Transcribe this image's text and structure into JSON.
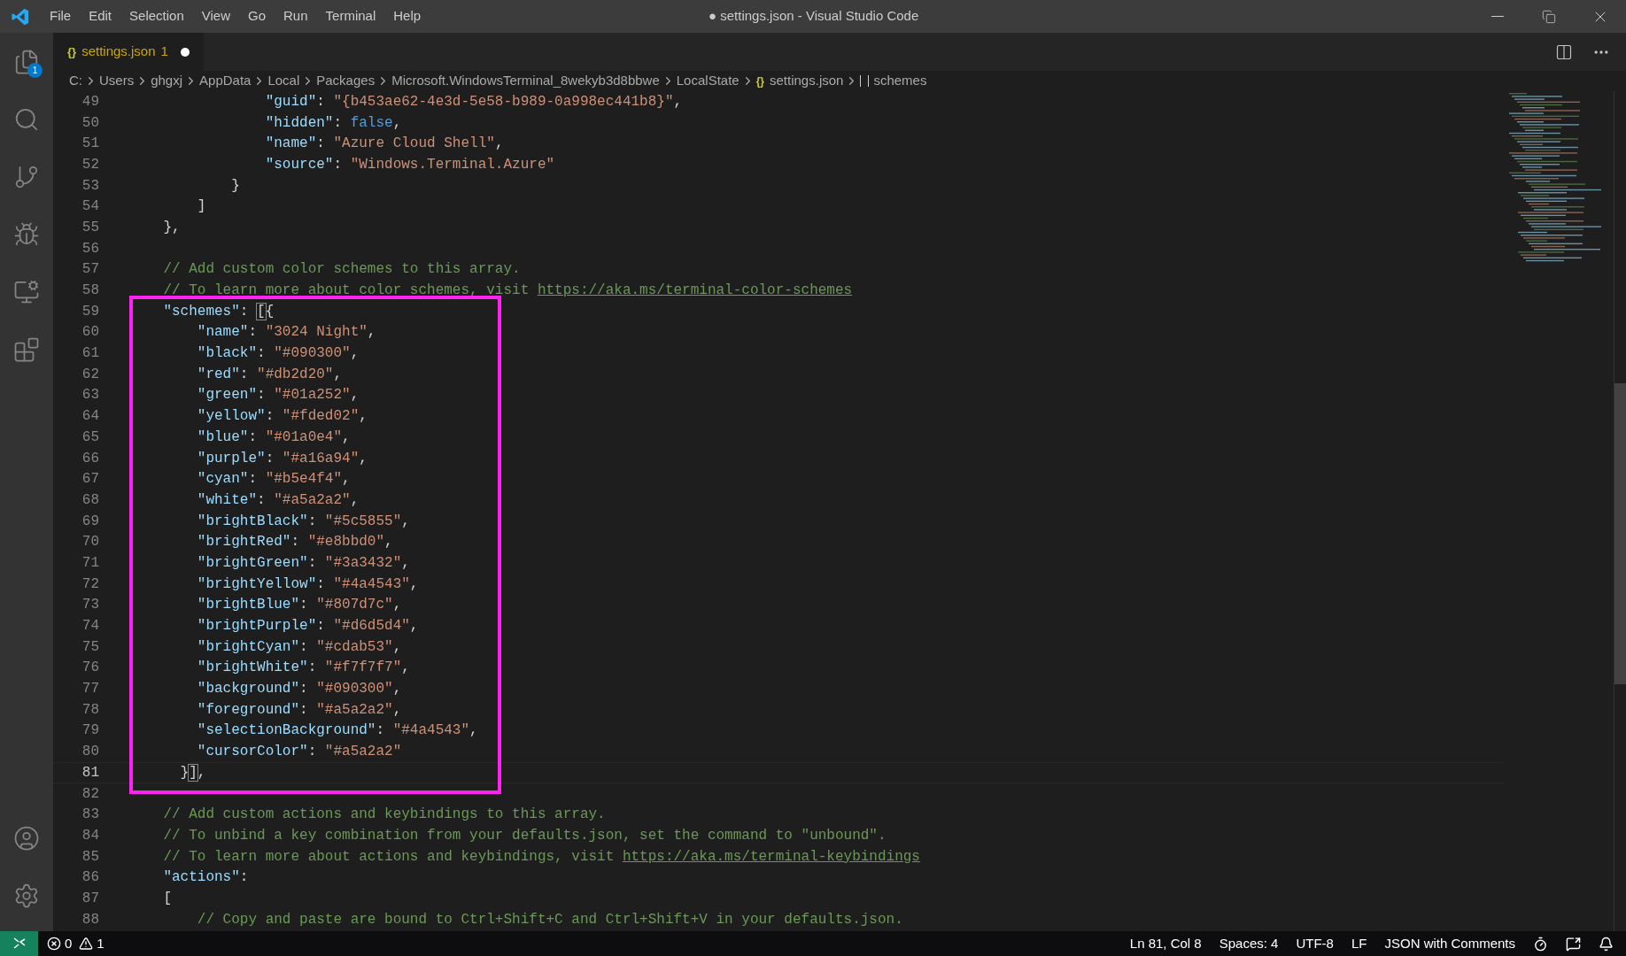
{
  "window": {
    "title": "● settings.json - Visual Studio Code",
    "menu": [
      "File",
      "Edit",
      "Selection",
      "View",
      "Go",
      "Run",
      "Terminal",
      "Help"
    ]
  },
  "activity_bar": {
    "top": [
      {
        "kind": "files",
        "badge": "1",
        "selected": false
      },
      {
        "kind": "search",
        "selected": false
      },
      {
        "kind": "source-control",
        "selected": false
      },
      {
        "kind": "run",
        "selected": false
      },
      {
        "kind": "remote",
        "selected": false
      },
      {
        "kind": "extensions",
        "selected": false
      }
    ],
    "bottom": [
      {
        "kind": "account"
      },
      {
        "kind": "settings"
      }
    ]
  },
  "tabs": [
    {
      "icon": "{}",
      "label": "settings.json",
      "problems": "1",
      "modified": true,
      "selected": true
    }
  ],
  "breadcrumb": [
    {
      "kind": "text",
      "label": "C:"
    },
    {
      "kind": "text",
      "label": "Users"
    },
    {
      "kind": "text",
      "label": "ghgxj"
    },
    {
      "kind": "text",
      "label": "AppData"
    },
    {
      "kind": "text",
      "label": "Local"
    },
    {
      "kind": "text",
      "label": "Packages"
    },
    {
      "kind": "text",
      "label": "Microsoft.WindowsTerminal_8wekyb3d8bbwe"
    },
    {
      "kind": "text",
      "label": "LocalState"
    },
    {
      "kind": "file",
      "icon": "{}",
      "label": "settings.json"
    },
    {
      "kind": "array",
      "label": "schemes"
    }
  ],
  "editor": {
    "blocks": [
      {
        "framed": false,
        "lines": [
          {
            "number": "49",
            "current": false,
            "tokens": [
              {
                "kind": "key",
                "text": "                \"guid\""
              },
              {
                "kind": "punct",
                "text": ": "
              },
              {
                "kind": "string",
                "text": "\"{b453ae62-4e3d-5e58-b989-0a998ec441b8}\""
              },
              {
                "kind": "punct",
                "text": ","
              }
            ]
          },
          {
            "number": "50",
            "current": false,
            "tokens": [
              {
                "kind": "key",
                "text": "                \"hidden\""
              },
              {
                "kind": "punct",
                "text": ": "
              },
              {
                "kind": "keyword",
                "text": "false"
              },
              {
                "kind": "punct",
                "text": ","
              }
            ]
          },
          {
            "number": "51",
            "current": false,
            "tokens": [
              {
                "kind": "key",
                "text": "                \"name\""
              },
              {
                "kind": "punct",
                "text": ": "
              },
              {
                "kind": "string",
                "text": "\"Azure Cloud Shell\""
              },
              {
                "kind": "punct",
                "text": ","
              }
            ]
          },
          {
            "number": "52",
            "current": false,
            "tokens": [
              {
                "kind": "key",
                "text": "                \"source\""
              },
              {
                "kind": "punct",
                "text": ": "
              },
              {
                "kind": "string",
                "text": "\"Windows.Terminal.Azure\""
              }
            ]
          },
          {
            "number": "53",
            "current": false,
            "tokens": [
              {
                "kind": "punct",
                "text": "            }"
              }
            ]
          },
          {
            "number": "54",
            "current": false,
            "tokens": [
              {
                "kind": "punct",
                "text": "        ]"
              }
            ]
          },
          {
            "number": "55",
            "current": false,
            "tokens": [
              {
                "kind": "punct",
                "text": "    },"
              }
            ]
          },
          {
            "number": "56",
            "current": false
          },
          {
            "number": "57",
            "current": false,
            "tokens": [
              {
                "kind": "comment",
                "text": "    // Add custom color schemes to this array."
              }
            ]
          },
          {
            "number": "58",
            "current": false,
            "tokens": [
              {
                "kind": "comment",
                "text": "    // To learn more about color schemes, visit "
              },
              {
                "kind": "link",
                "text": "https://aka.ms/terminal-color-schemes"
              }
            ]
          }
        ]
      },
      {
        "framed": true,
        "lines": [
          {
            "number": "59",
            "current": false,
            "tokens": [
              {
                "kind": "key",
                "text": "    \"schemes\""
              },
              {
                "kind": "punct",
                "text": ": "
              },
              {
                "kind": "bracket",
                "text": "["
              },
              {
                "kind": "punct",
                "text": "{"
              }
            ]
          },
          {
            "number": "60",
            "current": false,
            "tokens": [
              {
                "kind": "key",
                "text": "        \"name\""
              },
              {
                "kind": "punct",
                "text": ": "
              },
              {
                "kind": "string",
                "text": "\"3024 Night\""
              },
              {
                "kind": "punct",
                "text": ","
              }
            ]
          },
          {
            "number": "61",
            "current": false,
            "tokens": [
              {
                "kind": "key",
                "text": "        \"black\""
              },
              {
                "kind": "punct",
                "text": ": "
              },
              {
                "kind": "string",
                "text": "\"#090300\""
              },
              {
                "kind": "punct",
                "text": ","
              }
            ]
          },
          {
            "number": "62",
            "current": false,
            "tokens": [
              {
                "kind": "key",
                "text": "        \"red\""
              },
              {
                "kind": "punct",
                "text": ": "
              },
              {
                "kind": "string",
                "text": "\"#db2d20\""
              },
              {
                "kind": "punct",
                "text": ","
              }
            ]
          },
          {
            "number": "63",
            "current": false,
            "tokens": [
              {
                "kind": "key",
                "text": "        \"green\""
              },
              {
                "kind": "punct",
                "text": ": "
              },
              {
                "kind": "string",
                "text": "\"#01a252\""
              },
              {
                "kind": "punct",
                "text": ","
              }
            ]
          },
          {
            "number": "64",
            "current": false,
            "tokens": [
              {
                "kind": "key",
                "text": "        \"yellow\""
              },
              {
                "kind": "punct",
                "text": ": "
              },
              {
                "kind": "string",
                "text": "\"#fded02\""
              },
              {
                "kind": "punct",
                "text": ","
              }
            ]
          },
          {
            "number": "65",
            "current": false,
            "tokens": [
              {
                "kind": "key",
                "text": "        \"blue\""
              },
              {
                "kind": "punct",
                "text": ": "
              },
              {
                "kind": "string",
                "text": "\"#01a0e4\""
              },
              {
                "kind": "punct",
                "text": ","
              }
            ]
          },
          {
            "number": "66",
            "current": false,
            "tokens": [
              {
                "kind": "key",
                "text": "        \"purple\""
              },
              {
                "kind": "punct",
                "text": ": "
              },
              {
                "kind": "string",
                "text": "\"#a16a94\""
              },
              {
                "kind": "punct",
                "text": ","
              }
            ]
          },
          {
            "number": "67",
            "current": false,
            "tokens": [
              {
                "kind": "key",
                "text": "        \"cyan\""
              },
              {
                "kind": "punct",
                "text": ": "
              },
              {
                "kind": "string",
                "text": "\"#b5e4f4\""
              },
              {
                "kind": "punct",
                "text": ","
              }
            ]
          },
          {
            "number": "68",
            "current": false,
            "tokens": [
              {
                "kind": "key",
                "text": "        \"white\""
              },
              {
                "kind": "punct",
                "text": ": "
              },
              {
                "kind": "string",
                "text": "\"#a5a2a2\""
              },
              {
                "kind": "punct",
                "text": ","
              }
            ]
          },
          {
            "number": "69",
            "current": false,
            "tokens": [
              {
                "kind": "key",
                "text": "        \"brightBlack\""
              },
              {
                "kind": "punct",
                "text": ": "
              },
              {
                "kind": "string",
                "text": "\"#5c5855\""
              },
              {
                "kind": "punct",
                "text": ","
              }
            ]
          },
          {
            "number": "70",
            "current": false,
            "tokens": [
              {
                "kind": "key",
                "text": "        \"brightRed\""
              },
              {
                "kind": "punct",
                "text": ": "
              },
              {
                "kind": "string",
                "text": "\"#e8bbd0\""
              },
              {
                "kind": "punct",
                "text": ","
              }
            ]
          },
          {
            "number": "71",
            "current": false,
            "tokens": [
              {
                "kind": "key",
                "text": "        \"brightGreen\""
              },
              {
                "kind": "punct",
                "text": ": "
              },
              {
                "kind": "string",
                "text": "\"#3a3432\""
              },
              {
                "kind": "punct",
                "text": ","
              }
            ]
          },
          {
            "number": "72",
            "current": false,
            "tokens": [
              {
                "kind": "key",
                "text": "        \"brightYellow\""
              },
              {
                "kind": "punct",
                "text": ": "
              },
              {
                "kind": "string",
                "text": "\"#4a4543\""
              },
              {
                "kind": "punct",
                "text": ","
              }
            ]
          },
          {
            "number": "73",
            "current": false,
            "tokens": [
              {
                "kind": "key",
                "text": "        \"brightBlue\""
              },
              {
                "kind": "punct",
                "text": ": "
              },
              {
                "kind": "string",
                "text": "\"#807d7c\""
              },
              {
                "kind": "punct",
                "text": ","
              }
            ]
          },
          {
            "number": "74",
            "current": false,
            "tokens": [
              {
                "kind": "key",
                "text": "        \"brightPurple\""
              },
              {
                "kind": "punct",
                "text": ": "
              },
              {
                "kind": "string",
                "text": "\"#d6d5d4\""
              },
              {
                "kind": "punct",
                "text": ","
              }
            ]
          },
          {
            "number": "75",
            "current": false,
            "tokens": [
              {
                "kind": "key",
                "text": "        \"brightCyan\""
              },
              {
                "kind": "punct",
                "text": ": "
              },
              {
                "kind": "string",
                "text": "\"#cdab53\""
              },
              {
                "kind": "punct",
                "text": ","
              }
            ]
          },
          {
            "number": "76",
            "current": false,
            "tokens": [
              {
                "kind": "key",
                "text": "        \"brightWhite\""
              },
              {
                "kind": "punct",
                "text": ": "
              },
              {
                "kind": "string",
                "text": "\"#f7f7f7\""
              },
              {
                "kind": "punct",
                "text": ","
              }
            ]
          },
          {
            "number": "77",
            "current": false,
            "tokens": [
              {
                "kind": "key",
                "text": "        \"background\""
              },
              {
                "kind": "punct",
                "text": ": "
              },
              {
                "kind": "string",
                "text": "\"#090300\""
              },
              {
                "kind": "punct",
                "text": ","
              }
            ]
          },
          {
            "number": "78",
            "current": false,
            "tokens": [
              {
                "kind": "key",
                "text": "        \"foreground\""
              },
              {
                "kind": "punct",
                "text": ": "
              },
              {
                "kind": "string",
                "text": "\"#a5a2a2\""
              },
              {
                "kind": "punct",
                "text": ","
              }
            ]
          },
          {
            "number": "79",
            "current": false,
            "tokens": [
              {
                "kind": "key",
                "text": "        \"selectionBackground\""
              },
              {
                "kind": "punct",
                "text": ": "
              },
              {
                "kind": "string",
                "text": "\"#4a4543\""
              },
              {
                "kind": "punct",
                "text": ","
              }
            ]
          },
          {
            "number": "80",
            "current": false,
            "tokens": [
              {
                "kind": "key",
                "text": "        \"cursorColor\""
              },
              {
                "kind": "punct",
                "text": ": "
              },
              {
                "kind": "string",
                "text": "\"#a5a2a2\""
              }
            ]
          },
          {
            "number": "81",
            "current": true,
            "tokens": [
              {
                "kind": "punct",
                "text": "      }"
              },
              {
                "kind": "bracket",
                "text": "]"
              },
              {
                "kind": "punct",
                "text": ","
              }
            ]
          }
        ]
      },
      {
        "framed": false,
        "lines": [
          {
            "number": "82",
            "current": false
          },
          {
            "number": "83",
            "current": false,
            "tokens": [
              {
                "kind": "comment",
                "text": "    // Add custom actions and keybindings to this array."
              }
            ]
          },
          {
            "number": "84",
            "current": false,
            "tokens": [
              {
                "kind": "comment",
                "text": "    // To unbind a key combination from your defaults.json, set the command to \"unbound\"."
              }
            ]
          },
          {
            "number": "85",
            "current": false,
            "tokens": [
              {
                "kind": "comment",
                "text": "    // To learn more about actions and keybindings, visit "
              },
              {
                "kind": "link",
                "text": "https://aka.ms/terminal-keybindings"
              }
            ]
          },
          {
            "number": "86",
            "current": false,
            "tokens": [
              {
                "kind": "key",
                "text": "    \"actions\""
              },
              {
                "kind": "punct",
                "text": ":"
              }
            ]
          },
          {
            "number": "87",
            "current": false,
            "tokens": [
              {
                "kind": "punct",
                "text": "    ["
              }
            ]
          },
          {
            "number": "88",
            "current": false,
            "tokens": [
              {
                "kind": "comment",
                "text": "        // Copy and paste are bound to Ctrl+Shift+C and Ctrl+Shift+V in your defaults.json."
              }
            ]
          }
        ]
      }
    ]
  },
  "status_bar": {
    "errors": "0",
    "warnings": "1",
    "right": [
      {
        "kind": "text",
        "label": "Ln 81, Col 8"
      },
      {
        "kind": "text",
        "label": "Spaces: 4"
      },
      {
        "kind": "text",
        "label": "UTF-8"
      },
      {
        "kind": "text",
        "label": "LF"
      },
      {
        "kind": "text",
        "label": "JSON with Comments"
      },
      {
        "kind": "watch"
      },
      {
        "kind": "feedback"
      },
      {
        "kind": "bell"
      }
    ]
  }
}
